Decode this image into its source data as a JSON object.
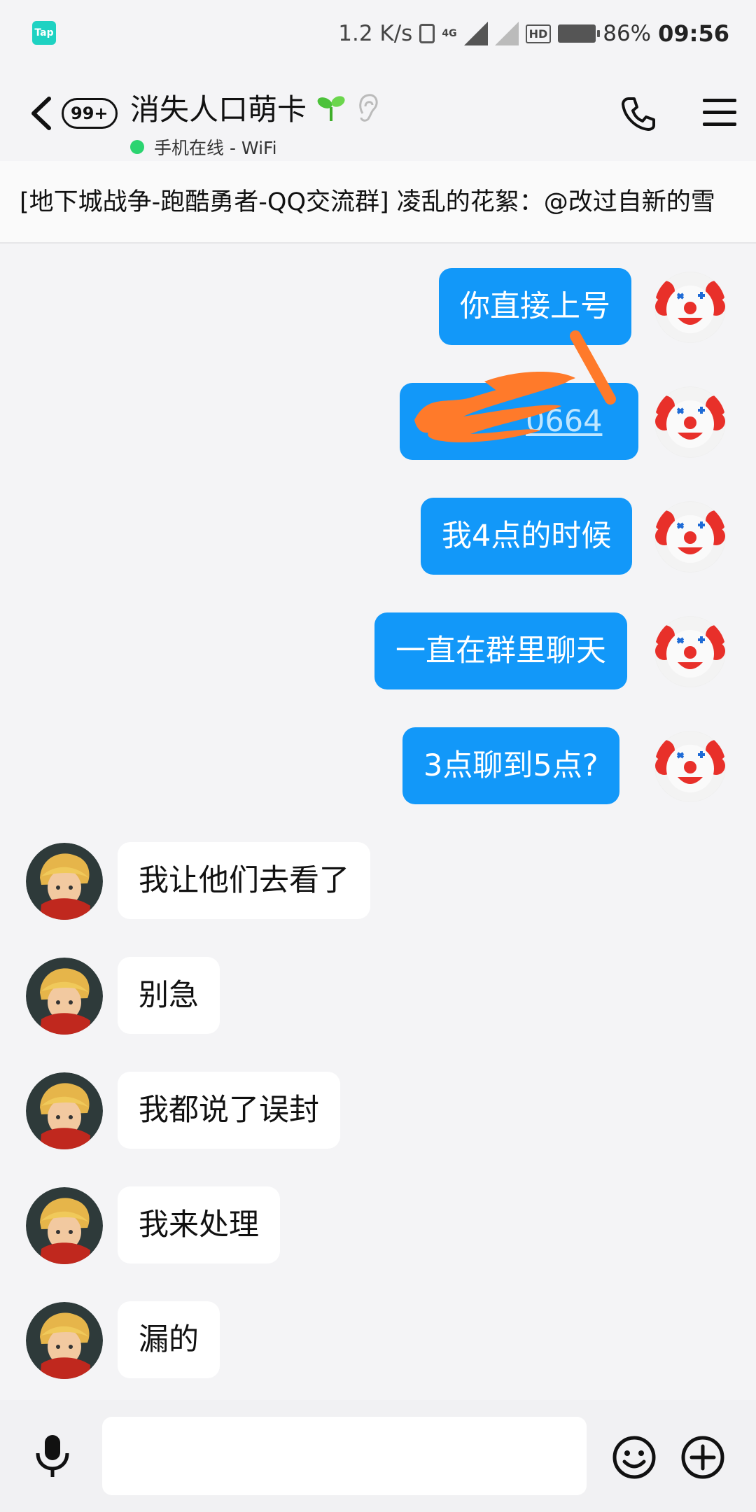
{
  "status_bar": {
    "app_icon_label": "Tap",
    "net_speed": "1.2 K/s",
    "net_type": "4G",
    "hd_label": "HD",
    "battery_pct": "86%",
    "time": "09:56"
  },
  "header": {
    "unread_badge": "99+",
    "contact_name": "消失人口萌卡",
    "status_text": "手机在线 - WiFi"
  },
  "notice_text": "[地下城战争-跑酷勇者-QQ交流群] 凌乱的花絮：@改过自新的雪",
  "messages": {
    "out": [
      {
        "text": "你直接上号"
      },
      {
        "text": "0664"
      },
      {
        "text": "我4点的时候"
      },
      {
        "text": "一直在群里聊天"
      },
      {
        "text": "3点聊到5点?"
      }
    ],
    "in": [
      {
        "text": "我让他们去看了"
      },
      {
        "text": "别急"
      },
      {
        "text": "我都说了误封"
      },
      {
        "text": "我来处理"
      },
      {
        "text": "漏的"
      }
    ]
  },
  "input": {
    "value": "",
    "placeholder": ""
  },
  "colors": {
    "bubble_out": "#1298f9",
    "bubble_in": "#ffffff",
    "online_dot": "#2bd470",
    "redaction": "#ff7a2a"
  }
}
